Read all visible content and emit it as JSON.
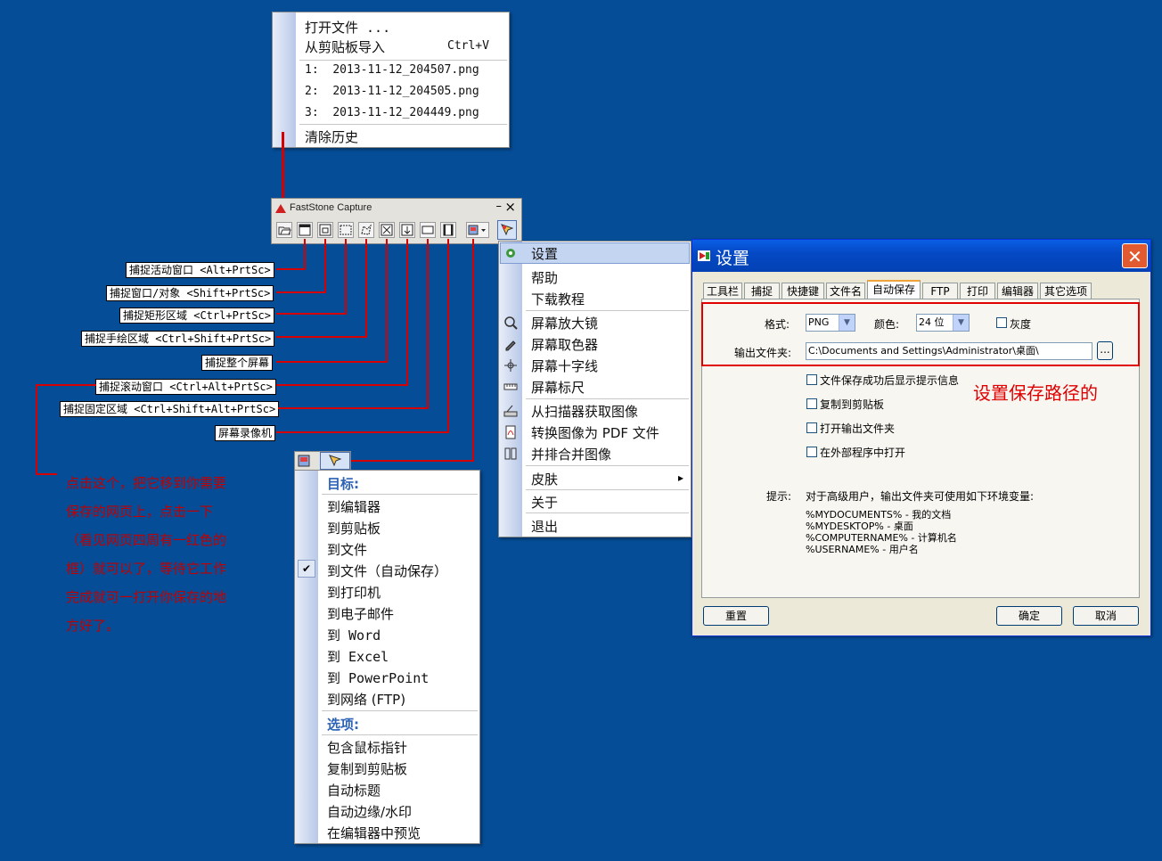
{
  "file_menu": {
    "open_file": "打开文件 ...",
    "import_clipboard": "从剪贴板导入",
    "import_shortcut": "Ctrl+V",
    "recent": [
      {
        "num": "1:",
        "name": "2013-11-12_204507.png"
      },
      {
        "num": "2:",
        "name": "2013-11-12_204505.png"
      },
      {
        "num": "3:",
        "name": "2013-11-12_204449.png"
      }
    ],
    "clear_history": "清除历史"
  },
  "toolbar": {
    "title": "FastStone Capture",
    "minimize": "–",
    "close": "×",
    "icons": [
      "open-icon",
      "capture-window-icon",
      "capture-object-icon",
      "capture-rect-icon",
      "capture-freehand-icon",
      "capture-fullscreen-icon",
      "capture-scroll-icon",
      "capture-fixed-icon",
      "screen-recorder-icon",
      "output-icon",
      "settings-icon"
    ]
  },
  "callouts": [
    "捕捉活动窗口 <Alt+PrtSc>",
    "捕捉窗口/对象 <Shift+PrtSc>",
    "捕捉矩形区域 <Ctrl+PrtSc>",
    "捕捉手绘区域 <Ctrl+Shift+PrtSc>",
    "捕捉整个屏幕",
    "捕捉滚动窗口 <Ctrl+Alt+PrtSc>",
    "捕捉固定区域 <Ctrl+Shift+Alt+PrtSc>",
    "屏幕录像机"
  ],
  "annotation": {
    "lines": [
      "点击这个，把它移到你需要",
      "保存的网页上，点击一下",
      "（看见网页四周有一红色的",
      "框）就可以了，等待它工作",
      "完成就可一打开你保存的地",
      "方好了。"
    ],
    "color": "#c00000"
  },
  "settings_menu": {
    "items": [
      {
        "label": "设置",
        "icon": "gear-icon"
      },
      {
        "label": "帮助",
        "icon": ""
      },
      {
        "label": "下载教程",
        "icon": ""
      },
      {
        "label": "屏幕放大镜",
        "icon": "magnifier-icon"
      },
      {
        "label": "屏幕取色器",
        "icon": "eyedropper-icon"
      },
      {
        "label": "屏幕十字线",
        "icon": "crosshair-icon"
      },
      {
        "label": "屏幕标尺",
        "icon": "ruler-icon"
      },
      {
        "label": "从扫描器获取图像",
        "icon": "scanner-icon"
      },
      {
        "label": "转换图像为 PDF 文件",
        "icon": "pdf-icon"
      },
      {
        "label": "并排合并图像",
        "icon": "combine-icon"
      },
      {
        "label": "皮肤",
        "icon": ""
      },
      {
        "label": "关于",
        "icon": ""
      },
      {
        "label": "退出",
        "icon": ""
      }
    ],
    "submenu_arrow": "▸"
  },
  "output_menu": {
    "target_header": "目标:",
    "targets": [
      "到编辑器",
      "到剪贴板",
      "到文件",
      "到文件（自动保存）",
      "到打印机",
      "到电子邮件",
      "到 Word",
      "到 Excel",
      "到 PowerPoint",
      "到网络 (FTP)"
    ],
    "checked_index": 3,
    "check_mark": "✔",
    "options_header": "选项:",
    "options": [
      "包含鼠标指针",
      "复制到剪贴板",
      "自动标题",
      "自动边缘/水印",
      "在编辑器中预览"
    ]
  },
  "dialog": {
    "title": "设置",
    "close": "✕",
    "tabs": [
      "工具栏",
      "捕捉",
      "快捷键",
      "文件名",
      "自动保存",
      "FTP",
      "打印",
      "编辑器",
      "其它选项"
    ],
    "active_tab": 4,
    "format_label": "格式:",
    "format_value": "PNG",
    "color_label": "颜色:",
    "color_value": "24 位",
    "grayscale_label": "灰度",
    "output_folder_label": "输出文件夹:",
    "output_folder_value": "C:\\Documents and Settings\\Administrator\\桌面\\",
    "browse": "...",
    "checkboxes": [
      "文件保存成功后显示提示信息",
      "复制到剪贴板",
      "打开输出文件夹",
      "在外部程序中打开"
    ],
    "annotation": "设置保存路径的",
    "hint_label": "提示:",
    "hint_text": "对于高级用户，输出文件夹可使用如下环境变量:",
    "env_vars": [
      "%MYDOCUMENTS% - 我的文档",
      "%MYDESKTOP% - 桌面",
      "%COMPUTERNAME% - 计算机名",
      "%USERNAME% - 用户名"
    ],
    "reset": "重置",
    "ok": "确定",
    "cancel": "取消"
  }
}
